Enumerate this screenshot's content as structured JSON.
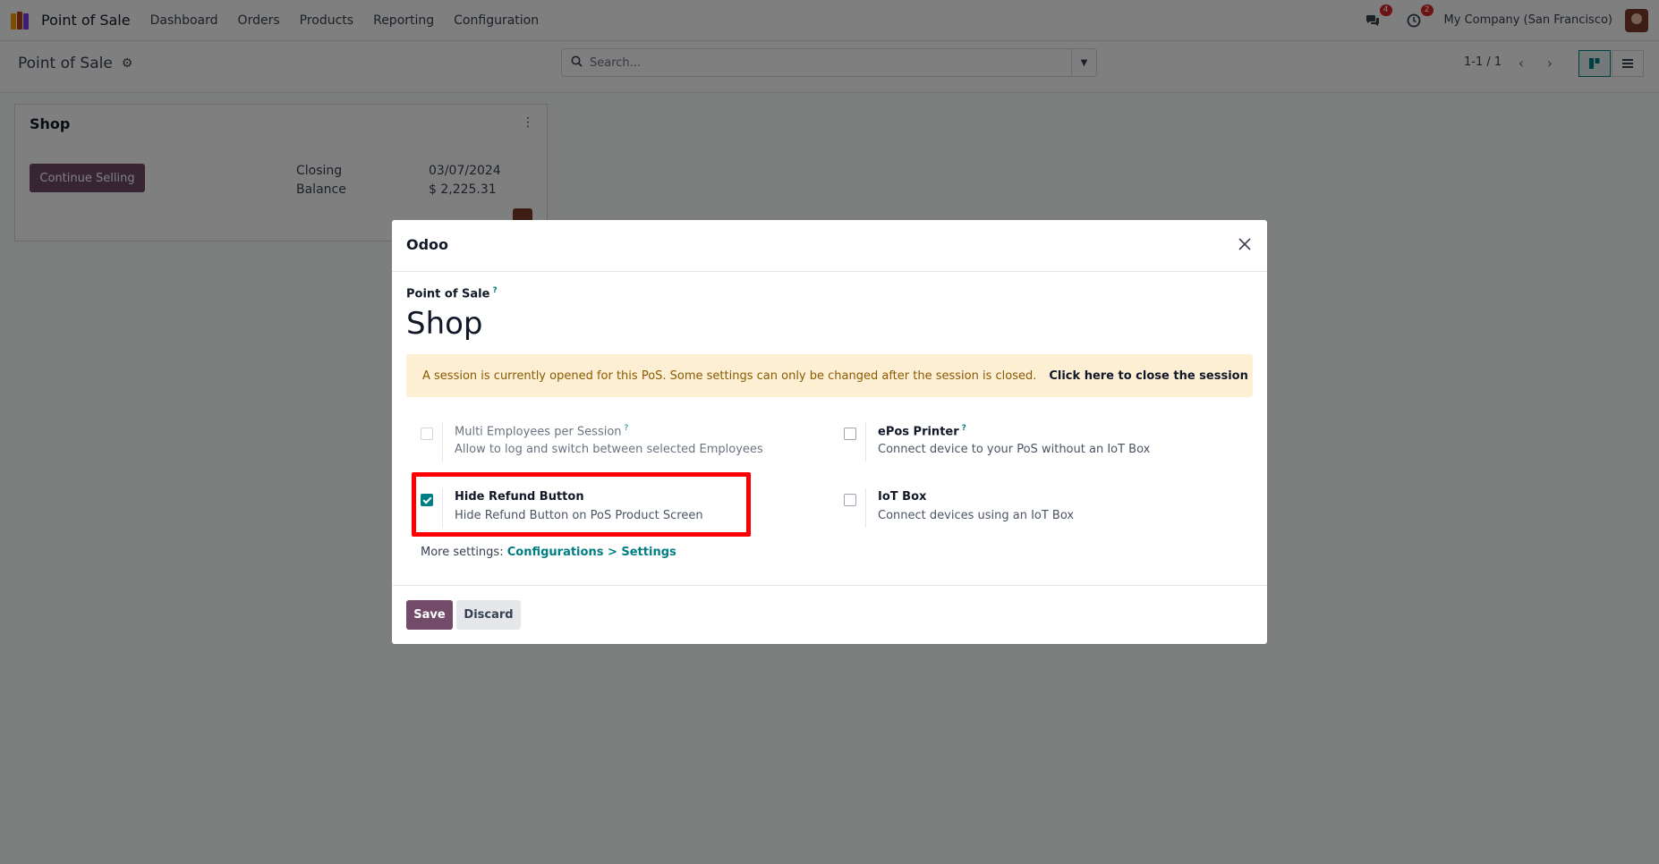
{
  "navbar": {
    "app_name": "Point of Sale",
    "menu": [
      "Dashboard",
      "Orders",
      "Products",
      "Reporting",
      "Configuration"
    ],
    "messages_badge": "4",
    "activities_badge": "2",
    "company": "My Company (San Francisco)",
    "icons": {
      "app": "pos-app-icon",
      "messages": "chat-icon",
      "activities": "clock-icon",
      "avatar": "user-avatar"
    }
  },
  "control_panel": {
    "breadcrumb": "Point of Sale",
    "search_placeholder": "Search...",
    "pager": "1-1 / 1"
  },
  "card": {
    "title": "Shop",
    "button": "Continue Selling",
    "closing_label": "Closing",
    "closing_value": "03/07/2024",
    "balance_label": "Balance",
    "balance_value": "$ 2,225.31"
  },
  "modal": {
    "title": "Odoo",
    "section_label": "Point of Sale",
    "help_mark": "?",
    "record_name": "Shop",
    "alert_text": "A session is currently opened for this PoS. Some settings can only be changed after the session is closed.",
    "alert_link": "Click here to close the session",
    "settings": [
      {
        "title": "Multi Employees per Session",
        "desc": "Allow to log and switch between selected Employees",
        "checked": false,
        "disabled": true
      },
      {
        "title": "ePos Printer",
        "desc": "Connect device to your PoS without an IoT Box",
        "checked": false,
        "disabled": false
      },
      {
        "title": "Hide Refund Button",
        "desc": "Hide Refund Button on PoS Product Screen",
        "checked": true,
        "disabled": false
      },
      {
        "title": "IoT Box",
        "desc": "Connect devices using an IoT Box",
        "checked": false,
        "disabled": false
      }
    ],
    "more_settings_label": "More settings:",
    "more_settings_link": "Configurations > Settings",
    "save_label": "Save",
    "discard_label": "Discard"
  },
  "colors": {
    "primary": "#714b67",
    "accent": "#017e84",
    "highlight": "#ff0000",
    "alert_bg": "#fdefd4"
  }
}
